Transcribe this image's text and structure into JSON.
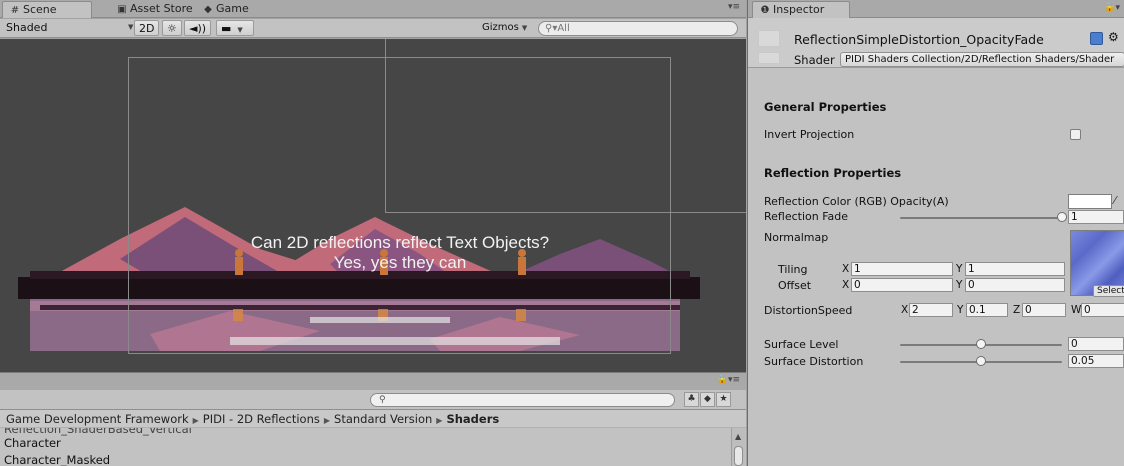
{
  "scene_tabs": [
    {
      "icon": "#",
      "label": "Scene"
    },
    {
      "icon": "▣",
      "label": "Asset Store"
    },
    {
      "icon": "◆",
      "label": "Game"
    }
  ],
  "scene_toolbar": {
    "shading_mode": "Shaded",
    "mode_2d": "2D",
    "gizmos_label": "Gizmos",
    "search_placeholder": "All"
  },
  "scene_text": {
    "line1": "Can 2D reflections reflect Text Objects?",
    "line2": "Yes, yes they can"
  },
  "project": {
    "breadcrumb": [
      "Game Development Framework",
      "PIDI - 2D Reflections",
      "Standard Version"
    ],
    "breadcrumb_current": "Shaders",
    "files": [
      "Reflection_ShaderBased_Vertical",
      "Character",
      "Character_Masked"
    ]
  },
  "inspector": {
    "tab_label": "Inspector",
    "material_name": "ReflectionSimpleDistortion_OpacityFade",
    "shader_label": "Shader",
    "shader_value": "PIDI Shaders Collection/2D/Reflection Shaders/Shader",
    "general_header": "General Properties",
    "invert_projection_label": "Invert Projection",
    "reflection_header": "Reflection Properties",
    "reflection_color_label": "Reflection Color (RGB) Opacity(A)",
    "reflection_color_hex": "#ffffff",
    "reflection_fade_label": "Reflection Fade",
    "reflection_fade_value": "1",
    "normalmap_label": "Normalmap",
    "tiling_label": "Tiling",
    "tiling_x": "1",
    "tiling_y": "1",
    "offset_label": "Offset",
    "offset_x": "0",
    "offset_y": "0",
    "select_label": "Select",
    "distortion_speed_label": "DistortionSpeed",
    "distortion_x": "2",
    "distortion_y": "0.1",
    "distortion_z": "0",
    "distortion_w": "0",
    "surface_level_label": "Surface Level",
    "surface_level_value": "0",
    "surface_distortion_label": "Surface Distortion",
    "surface_distortion_value": "0.05",
    "axis_x": "X",
    "axis_y": "Y",
    "axis_z": "Z",
    "axis_w": "W"
  },
  "colors": {
    "scene_bg": "#464646",
    "mountain_pink": "#c06a7a",
    "mountain_purple": "#7a4f78",
    "water": "#8a6a86",
    "normalmap": "#6a7ad0"
  }
}
